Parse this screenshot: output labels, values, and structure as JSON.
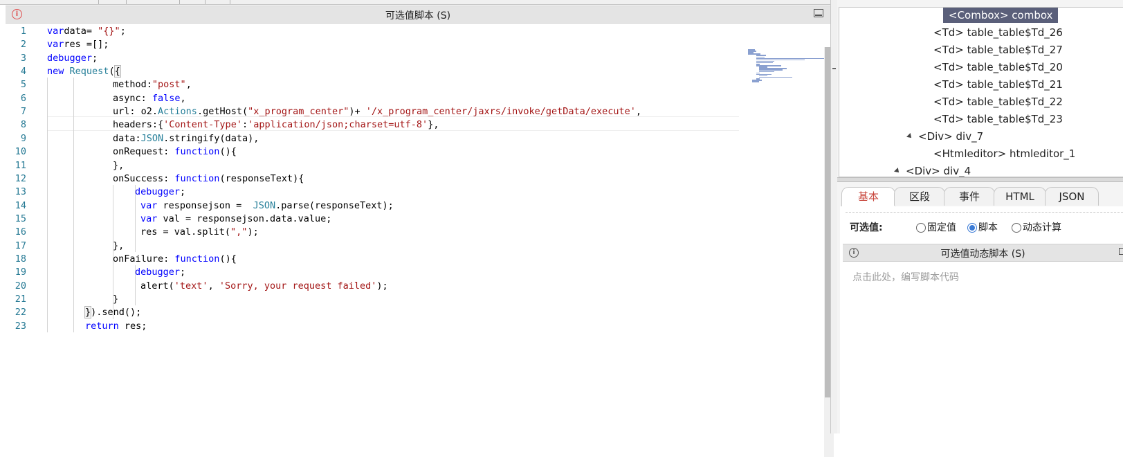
{
  "editor": {
    "title": "可选值脚本 (S)",
    "line_numbers": [
      "1",
      "2",
      "3",
      "4",
      "5",
      "6",
      "7",
      "8",
      "9",
      "10",
      "11",
      "12",
      "13",
      "14",
      "15",
      "16",
      "17",
      "18",
      "19",
      "20",
      "21",
      "22",
      "23"
    ],
    "lines": [
      [
        [
          "kw",
          "var"
        ],
        [
          "",
          "data= "
        ],
        [
          "st",
          "\"{}\""
        ],
        [
          "",
          ";"
        ]
      ],
      [
        [
          "kw",
          "var"
        ],
        [
          "",
          "res =[];"
        ]
      ],
      [
        [
          "kw",
          "debugger"
        ],
        [
          "",
          ";"
        ]
      ],
      [
        [
          "kw",
          "new"
        ],
        [
          "",
          " "
        ],
        [
          "ty",
          "Request"
        ],
        [
          "",
          "("
        ],
        [
          "bh",
          "{"
        ]
      ],
      [
        [
          "",
          "method:"
        ],
        [
          "st",
          "\"post\""
        ],
        [
          "",
          ","
        ]
      ],
      [
        [
          "",
          "async: "
        ],
        [
          "kw",
          "false"
        ],
        [
          "",
          ","
        ]
      ],
      [
        [
          "",
          "url: o2."
        ],
        [
          "ty",
          "Actions"
        ],
        [
          "",
          ".getHost("
        ],
        [
          "st",
          "\"x_program_center\""
        ],
        [
          "",
          ")+ "
        ],
        [
          "st",
          "'/x_program_center/jaxrs/invoke/getData/execute'"
        ],
        [
          "",
          ","
        ]
      ],
      [
        [
          "",
          "headers:{"
        ],
        [
          "st",
          "'Content-Type'"
        ],
        [
          "",
          ":"
        ],
        [
          "st",
          "'application/json;charset=utf-8'"
        ],
        [
          "",
          "},"
        ]
      ],
      [
        [
          "",
          "data:"
        ],
        [
          "ty",
          "JSON"
        ],
        [
          "",
          ".stringify(data),"
        ]
      ],
      [
        [
          "",
          "onRequest: "
        ],
        [
          "kw",
          "function"
        ],
        [
          "",
          "(){"
        ]
      ],
      [
        [
          "",
          "},"
        ]
      ],
      [
        [
          "",
          "onSuccess: "
        ],
        [
          "kw",
          "function"
        ],
        [
          "",
          "(responseText){"
        ]
      ],
      [
        [
          "kw",
          "debugger"
        ],
        [
          "",
          ";"
        ]
      ],
      [
        [
          "kw",
          "var"
        ],
        [
          "",
          " responsejson =  "
        ],
        [
          "ty",
          "JSON"
        ],
        [
          "",
          ".parse(responseText);"
        ]
      ],
      [
        [
          "kw",
          "var"
        ],
        [
          "",
          " val = responsejson.data.value;"
        ]
      ],
      [
        [
          "",
          "res = val.split("
        ],
        [
          "st",
          "\",\""
        ],
        [
          "",
          ");"
        ]
      ],
      [
        [
          "",
          "},"
        ]
      ],
      [
        [
          "",
          "onFailure: "
        ],
        [
          "kw",
          "function"
        ],
        [
          "",
          "(){"
        ]
      ],
      [
        [
          "kw",
          "debugger"
        ],
        [
          "",
          ";"
        ]
      ],
      [
        [
          "",
          "alert("
        ],
        [
          "st",
          "'text'"
        ],
        [
          "",
          ", "
        ],
        [
          "st",
          "'Sorry, your request failed'"
        ],
        [
          "",
          ");"
        ]
      ],
      [
        [
          "",
          "}"
        ]
      ],
      [
        [
          "bh",
          "}"
        ],
        [
          "",
          ").send();"
        ]
      ],
      [
        [
          "kw",
          "return"
        ],
        [
          "",
          " res;"
        ]
      ]
    ]
  },
  "tree": {
    "nodes": [
      {
        "label": "<Combox> combox",
        "selected": true
      },
      {
        "label": "<Td> table_table$Td_26"
      },
      {
        "label": "<Td> table_table$Td_27"
      },
      {
        "label": "<Td> table_table$Td_20"
      },
      {
        "label": "<Td> table_table$Td_21"
      },
      {
        "label": "<Td> table_table$Td_22"
      },
      {
        "label": "<Td> table_table$Td_23"
      },
      {
        "label": "<Div> div_7",
        "expander": true
      },
      {
        "label": "<Htmleditor> htmleditor_1"
      },
      {
        "label": "<Div> div_4",
        "expander": true
      }
    ]
  },
  "tabs": [
    {
      "label": "基本",
      "active": true
    },
    {
      "label": "区段"
    },
    {
      "label": "事件"
    },
    {
      "label": "HTML"
    },
    {
      "label": "JSON"
    }
  ],
  "props": {
    "option_label": "可选值:",
    "radios": [
      {
        "label": "固定值",
        "checked": false
      },
      {
        "label": "脚本",
        "checked": true
      },
      {
        "label": "动态计算",
        "checked": false
      }
    ],
    "script_title": "可选值动态脚本 (S)",
    "script_placeholder": "点击此处，编写脚本代码"
  },
  "colors": {
    "keyword": "#0000ff",
    "type": "#267f99",
    "string": "#a31515",
    "tab_active": "#c8463c",
    "selected_node": "#5a5f7a"
  }
}
